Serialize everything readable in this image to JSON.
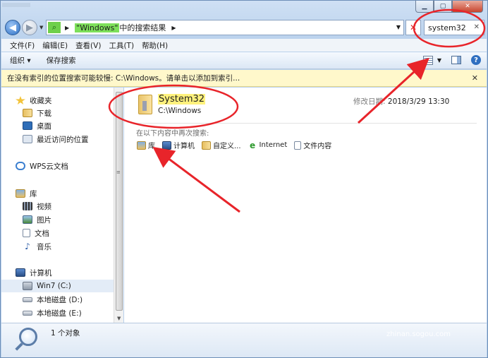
{
  "window": {
    "caption_buttons": [
      "minimize",
      "maximize",
      "close"
    ]
  },
  "nav": {
    "address": {
      "highlight": "\"Windows\"",
      "text": "中的搜索结果"
    },
    "search_value": "system32"
  },
  "menu": [
    "文件(F)",
    "编辑(E)",
    "查看(V)",
    "工具(T)",
    "帮助(H)"
  ],
  "commands": {
    "organize": "组织 ▾",
    "save_search": "保存搜索"
  },
  "infobar": {
    "text": "在没有索引的位置搜索可能较慢: C:\\Windows。请单击以添加到索引..."
  },
  "sidebar": {
    "favorites": "收藏夹",
    "downloads": "下载",
    "desktop": "桌面",
    "recent": "最近访问的位置",
    "wps": "WPS云文档",
    "libraries": "库",
    "video": "视频",
    "pictures": "图片",
    "documents": "文档",
    "music": "音乐",
    "computer": "计算机",
    "drive_c": "Win7 (C:)",
    "drive_d": "本地磁盘 (D:)",
    "drive_e": "本地磁盘 (E:)"
  },
  "result": {
    "name": "System32",
    "path": "C:\\Windows",
    "modified_label": "修改日期:",
    "modified_value": "2018/3/29 13:30"
  },
  "search_again": {
    "label": "在以下内容中再次搜索:",
    "items": [
      "库",
      "计算机",
      "自定义...",
      "Internet",
      "文件内容"
    ]
  },
  "status": {
    "count": "1 个对象"
  },
  "watermark": {
    "brand": "S 搜狗指南",
    "url": "zhinan.sogou.com"
  },
  "colors": {
    "annotation": "#e8242a",
    "infobar": "#fff8cb",
    "highlight": "#fff27d"
  }
}
